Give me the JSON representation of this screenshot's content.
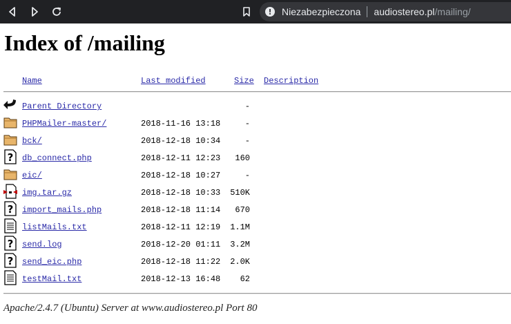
{
  "browser": {
    "security_label": "Niezabezpieczona",
    "url_host": "audiostereo.pl",
    "url_path": "/mailing/"
  },
  "page": {
    "title": "Index of /mailing",
    "headers": {
      "name": "Name",
      "last_modified": "Last modified",
      "size": "Size",
      "description": "Description"
    },
    "rows": [
      {
        "icon": "back-icon",
        "name": "Parent Directory",
        "modified": "",
        "size": "-"
      },
      {
        "icon": "folder-icon",
        "name": "PHPMailer-master/",
        "modified": "2018-11-16 13:18",
        "size": "-"
      },
      {
        "icon": "folder-icon",
        "name": "bck/",
        "modified": "2018-12-18 10:34",
        "size": "-"
      },
      {
        "icon": "unknown-file-icon",
        "name": "db_connect.php",
        "modified": "2018-12-11 12:23",
        "size": "160"
      },
      {
        "icon": "folder-icon",
        "name": "eic/",
        "modified": "2018-12-18 10:27",
        "size": "-"
      },
      {
        "icon": "compressed-file-icon",
        "name": "img.tar.gz",
        "modified": "2018-12-18 10:33",
        "size": "510K"
      },
      {
        "icon": "unknown-file-icon",
        "name": "import_mails.php",
        "modified": "2018-12-18 11:14",
        "size": "670"
      },
      {
        "icon": "text-file-icon",
        "name": "listMails.txt",
        "modified": "2018-12-11 12:19",
        "size": "1.1M"
      },
      {
        "icon": "unknown-file-icon",
        "name": "send.log",
        "modified": "2018-12-20 01:11",
        "size": "3.2M"
      },
      {
        "icon": "unknown-file-icon",
        "name": "send_eic.php",
        "modified": "2018-12-18 11:22",
        "size": "2.0K"
      },
      {
        "icon": "text-file-icon",
        "name": "testMail.txt",
        "modified": "2018-12-13 16:48",
        "size": "62"
      }
    ],
    "footer": "Apache/2.4.7 (Ubuntu) Server at www.audiostereo.pl Port 80"
  }
}
